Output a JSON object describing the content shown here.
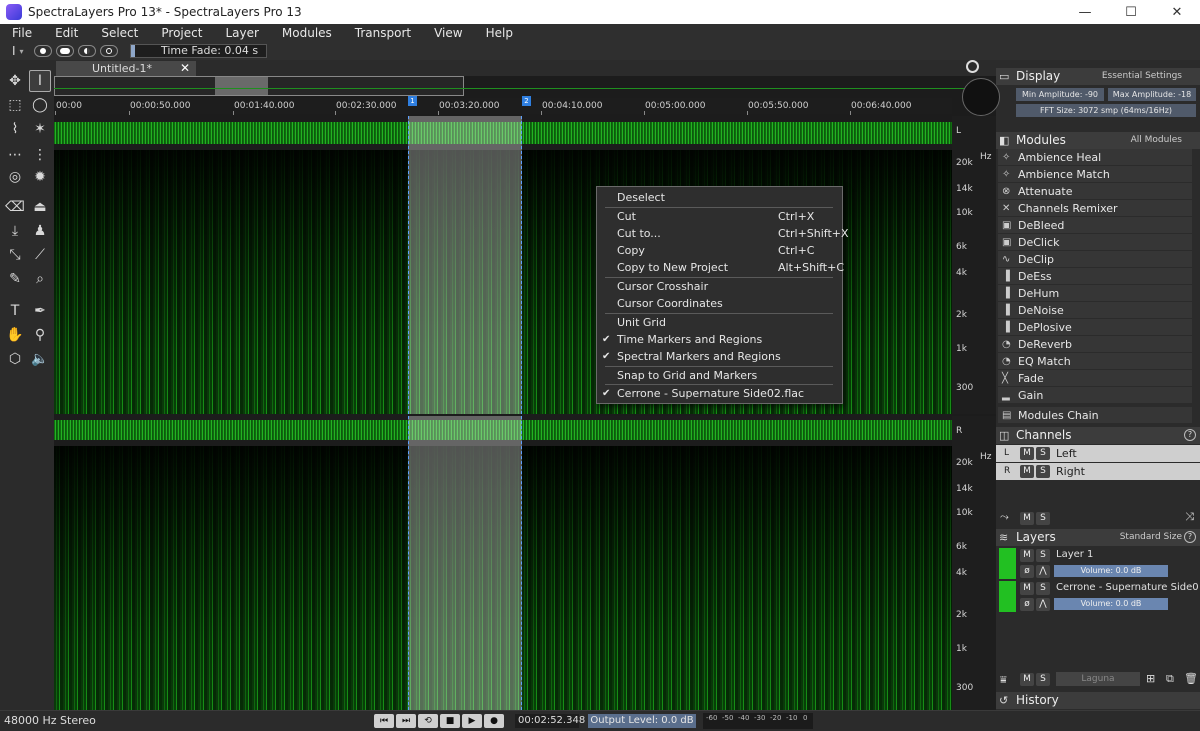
{
  "window": {
    "title": "SpectraLayers Pro 13* - SpectraLayers Pro 13",
    "minimize": "—",
    "maximize": "☐",
    "close": "✕"
  },
  "menu": [
    "File",
    "Edit",
    "Select",
    "Project",
    "Layer",
    "Modules",
    "Transport",
    "View",
    "Help"
  ],
  "toolbar": {
    "time_fade": "Time Fade: 0.04 s"
  },
  "tab": {
    "label": "Untitled-1*",
    "close": "✕"
  },
  "ruler": [
    "00:00",
    "00:00:50.000",
    "00:01:40.000",
    "00:02:30.000",
    "00:03:20.000",
    "00:04:10.000",
    "00:05:00.000",
    "00:05:50.000",
    "00:06:40.000"
  ],
  "markers": [
    "1",
    "2"
  ],
  "freq_labels": [
    "20k",
    "14k",
    "10k",
    "6k",
    "4k",
    "2k",
    "1k",
    "300"
  ],
  "channel_letters": {
    "left": "L",
    "right": "R",
    "hz": "Hz"
  },
  "context_menu": {
    "items": [
      {
        "label": "Deselect",
        "shortcut": "",
        "checked": false
      },
      {
        "label": "Cut",
        "shortcut": "Ctrl+X",
        "checked": false
      },
      {
        "label": "Cut to...",
        "shortcut": "Ctrl+Shift+X",
        "checked": false
      },
      {
        "label": "Copy",
        "shortcut": "Ctrl+C",
        "checked": false
      },
      {
        "label": "Copy to New Project",
        "shortcut": "Alt+Shift+C",
        "checked": false
      },
      {
        "label": "Cursor Crosshair",
        "shortcut": "",
        "checked": false
      },
      {
        "label": "Cursor Coordinates",
        "shortcut": "",
        "checked": false
      },
      {
        "label": "Unit Grid",
        "shortcut": "",
        "checked": false
      },
      {
        "label": "Time Markers and Regions",
        "shortcut": "",
        "checked": true
      },
      {
        "label": "Spectral Markers and Regions",
        "shortcut": "",
        "checked": true
      },
      {
        "label": "Snap to Grid and Markers",
        "shortcut": "",
        "checked": false
      },
      {
        "label": "Cerrone - Supernature Side02.flac",
        "shortcut": "",
        "checked": true
      }
    ]
  },
  "display": {
    "title": "Display",
    "preset": "Essential Settings",
    "min_amp": "Min Amplitude: -90 dB",
    "max_amp": "Max Amplitude: -18 dB",
    "fft": "FFT Size: 3072 smp (64ms/16Hz)"
  },
  "modules": {
    "title": "Modules",
    "filter": "All Modules",
    "items": [
      "Ambience Heal",
      "Ambience Match",
      "Attenuate",
      "Channels Remixer",
      "DeBleed",
      "DeClick",
      "DeClip",
      "DeEss",
      "DeHum",
      "DeNoise",
      "DePlosive",
      "DeReverb",
      "EQ Match",
      "Fade",
      "Gain",
      "Modules Chain"
    ]
  },
  "channels": {
    "title": "Channels",
    "rows": [
      {
        "letter": "L",
        "name": "Left"
      },
      {
        "letter": "R",
        "name": "Right"
      }
    ],
    "mute": "M",
    "solo": "S"
  },
  "layers": {
    "title": "Layers",
    "size": "Standard Size",
    "items": [
      {
        "name": "Layer 1",
        "volume": "Volume: 0.0 dB"
      },
      {
        "name": "Cerrone - Supernature Side02.flac",
        "volume": "Volume: 0.0 dB"
      }
    ],
    "blend": "Laguna"
  },
  "history": {
    "title": "History"
  },
  "status": {
    "format": "48000 Hz Stereo",
    "time": "00:02:52.348",
    "output_level": "Output Level: 0.0 dB",
    "meter_ticks": [
      "-60",
      "-50",
      "-40",
      "-30",
      "-20",
      "-10",
      "0"
    ]
  }
}
